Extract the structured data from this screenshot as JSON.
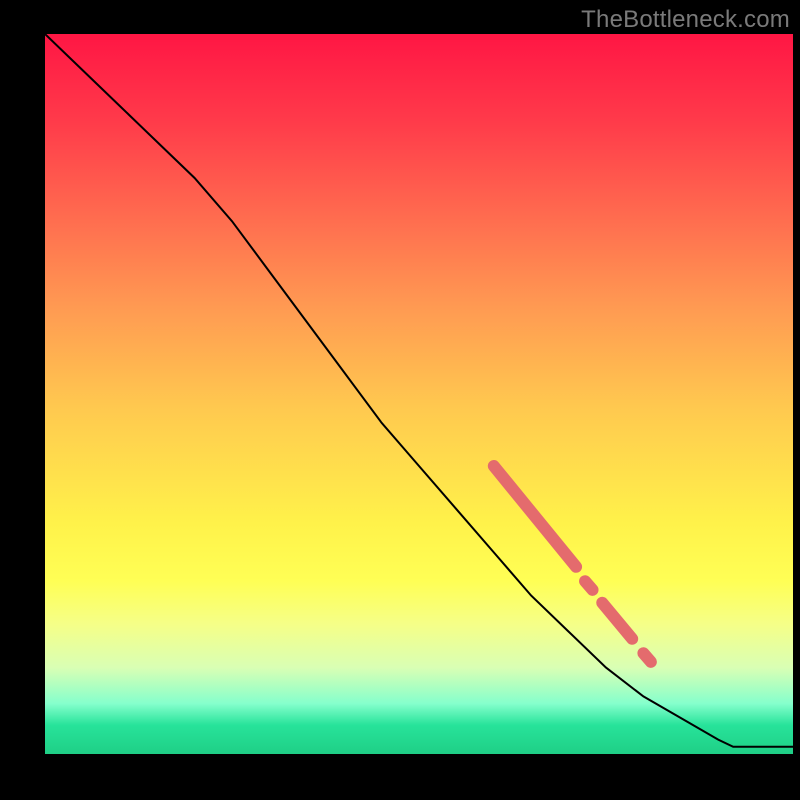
{
  "watermark": "TheBottleneck.com",
  "colors": {
    "line": "#000000",
    "highlight": "#e46b6d",
    "frame_bg": "#000000"
  },
  "chart_data": {
    "type": "line",
    "title": "",
    "xlabel": "",
    "ylabel": "",
    "xlim": [
      0,
      100
    ],
    "ylim": [
      0,
      100
    ],
    "grid": false,
    "series": [
      {
        "name": "curve",
        "x": [
          0,
          5,
          10,
          15,
          20,
          25,
          30,
          35,
          40,
          45,
          50,
          55,
          60,
          65,
          70,
          75,
          80,
          85,
          90,
          92,
          100
        ],
        "y": [
          100,
          95,
          90,
          85,
          80,
          74,
          67,
          60,
          53,
          46,
          40,
          34,
          28,
          22,
          17,
          12,
          8,
          5,
          2,
          1,
          1
        ]
      }
    ],
    "highlight_segments": [
      {
        "x0": 60,
        "y0": 40,
        "x1": 71,
        "y1": 26,
        "thick": true
      },
      {
        "x0": 72.2,
        "y0": 24.0,
        "x1": 73.2,
        "y1": 22.8,
        "thick": true
      },
      {
        "x0": 74.5,
        "y0": 21.0,
        "x1": 78.5,
        "y1": 16.0,
        "thick": true
      },
      {
        "x0": 80.0,
        "y0": 14.0,
        "x1": 81.0,
        "y1": 12.8,
        "thick": true
      }
    ]
  }
}
